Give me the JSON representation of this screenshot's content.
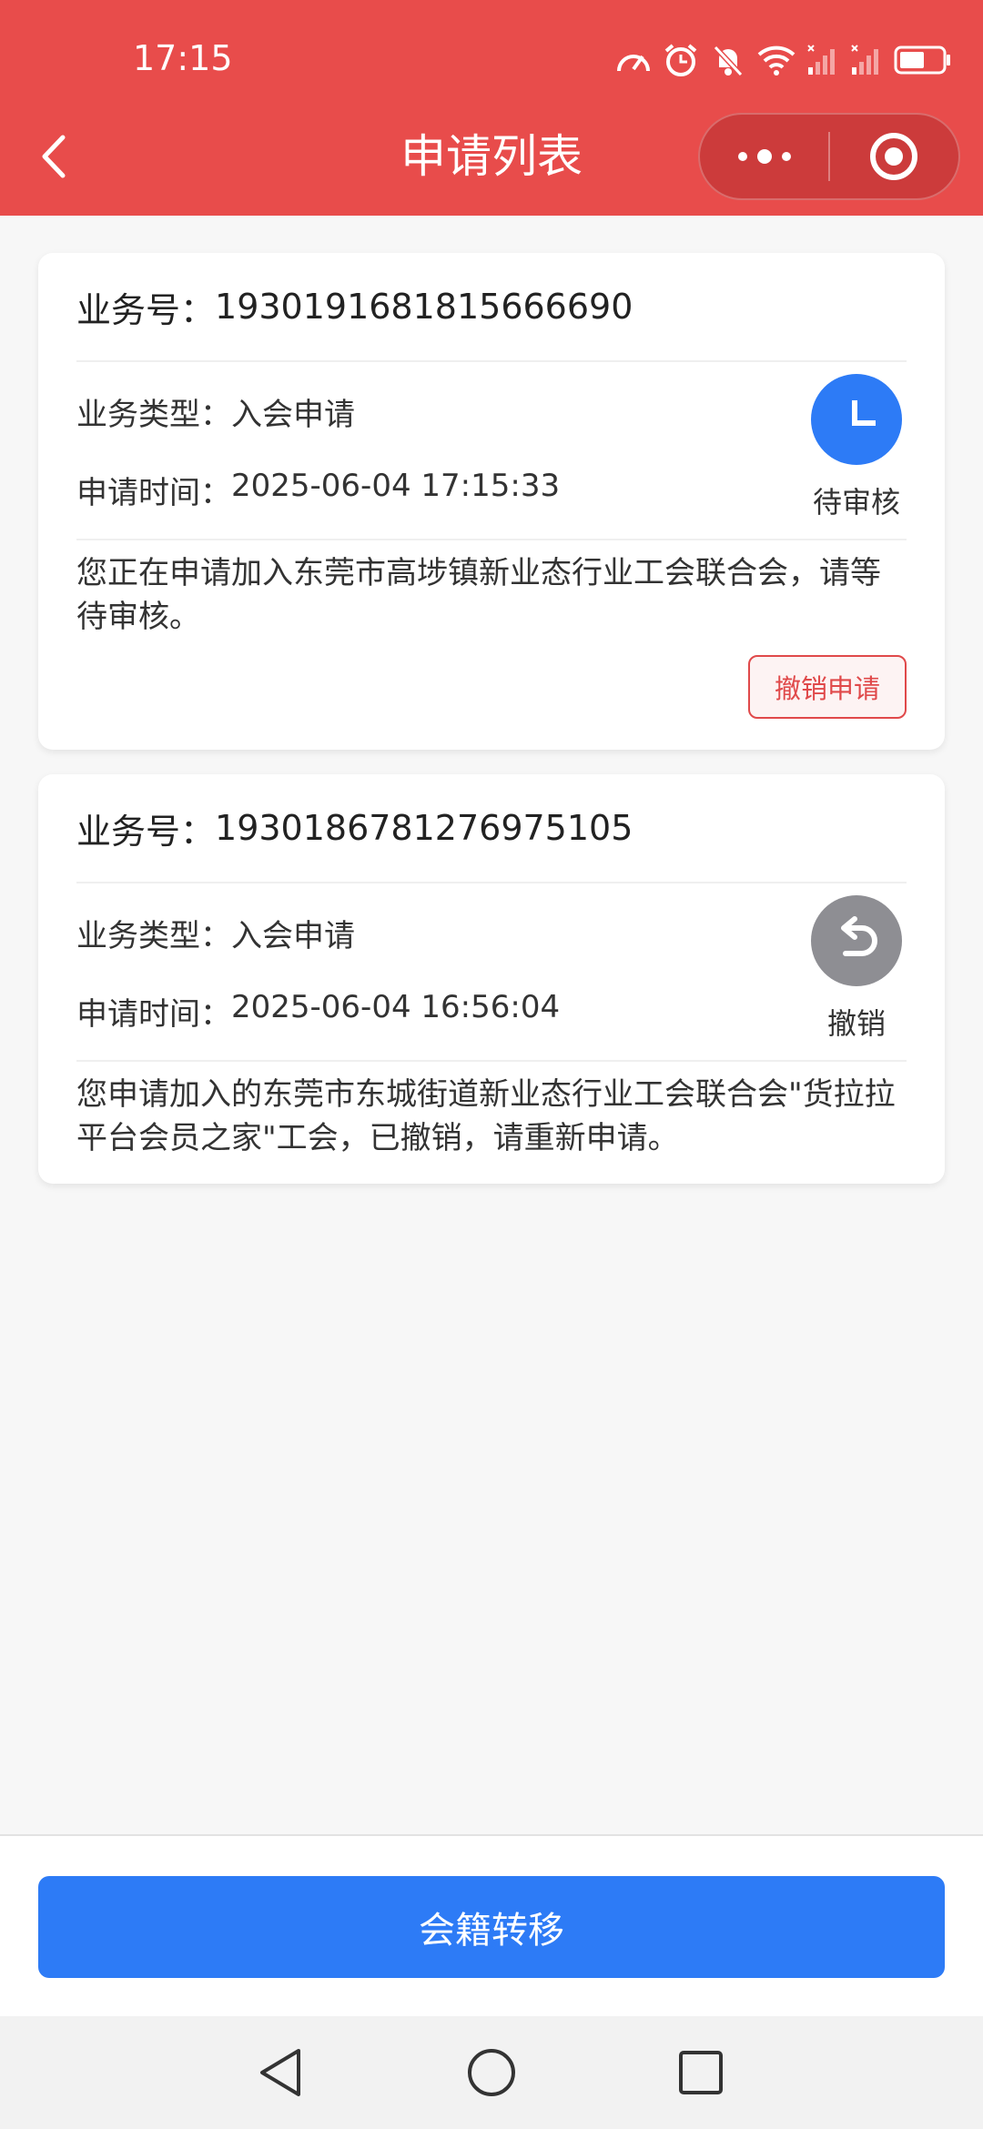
{
  "status_bar": {
    "time": "17:15",
    "icons": [
      "speed-meter-icon",
      "alarm-icon",
      "mute-bell-icon",
      "wifi-icon",
      "signal-icon",
      "signal-icon",
      "battery-icon"
    ]
  },
  "nav": {
    "title": "申请列表",
    "back_icon": "chevron-left-icon",
    "more_icon": "more-dots-icon",
    "close_icon": "target-circle-icon"
  },
  "applications": [
    {
      "business_no_label": "业务号：",
      "business_no": "1930191681815666690",
      "type_label": "业务类型：",
      "type": "入会申请",
      "time_label": "申请时间：",
      "time": "2025-06-04 17:15:33",
      "status": "待审核",
      "status_icon": "clock-icon",
      "status_color": "#2d7bf6",
      "description": "您正在申请加入东莞市高埗镇新业态行业工会联合会，请等待审核。",
      "action_label": "撤销申请"
    },
    {
      "business_no_label": "业务号：",
      "business_no": "1930186781276975105",
      "type_label": "业务类型：",
      "type": "入会申请",
      "time_label": "申请时间：",
      "time": "2025-06-04 16:56:04",
      "status": "撤销",
      "status_icon": "undo-arrow-icon",
      "status_color": "#8e8e93",
      "description": "您申请加入的东莞市东城街道新业态行业工会联合会\"货拉拉平台会员之家\"工会，已撤销，请重新申请。"
    }
  ],
  "footer": {
    "primary_button": "会籍转移"
  },
  "system_nav": [
    "back-triangle-icon",
    "home-circle-icon",
    "recents-square-icon"
  ],
  "colors": {
    "header": "#e84c4b",
    "primary": "#2d7bf6",
    "danger": "#e0494a"
  }
}
